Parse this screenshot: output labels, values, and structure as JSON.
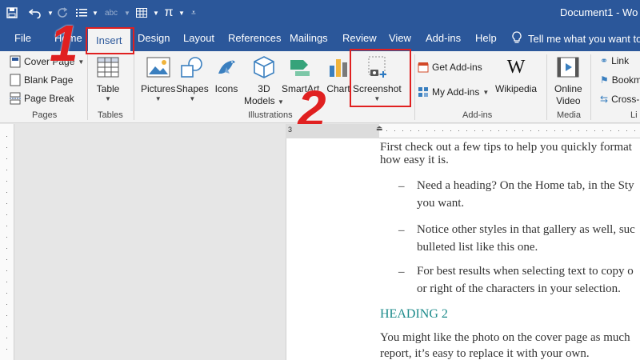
{
  "title_bar": {
    "document_title": "Document1 - Wo",
    "qat_icons": [
      "save-icon",
      "undo-icon",
      "redo-icon",
      "bullets-icon",
      "spelling-icon",
      "table-icon",
      "equation-icon",
      "customize-icon"
    ],
    "equation_glyph": "π"
  },
  "tabs": {
    "file": "File",
    "home": "Home",
    "insert": "Insert",
    "design": "Design",
    "layout": "Layout",
    "references": "References",
    "mailings": "Mailings",
    "review": "Review",
    "view": "View",
    "addins": "Add-ins",
    "help": "Help",
    "tell_me": "Tell me what you want to"
  },
  "ribbon": {
    "pages": {
      "cover_page": "Cover Page",
      "blank_page": "Blank Page",
      "page_break": "Page Break",
      "group_label": "Pages"
    },
    "tables": {
      "table": "Table",
      "group_label": "Tables"
    },
    "illustrations": {
      "pictures": "Pictures",
      "shapes": "Shapes",
      "icons": "Icons",
      "models_3d_line1": "3D",
      "models_3d_line2": "Models",
      "smartart": "SmartArt",
      "chart": "Chart",
      "screenshot": "Screenshot",
      "group_label": "Illustrations"
    },
    "addins": {
      "get_addins": "Get Add-ins",
      "my_addins": "My Add-ins",
      "wikipedia": "Wikipedia",
      "group_label": "Add-ins"
    },
    "media": {
      "online_video_line1": "Online",
      "online_video_line2": "Video",
      "group_label": "Media"
    },
    "links": {
      "link": "Link",
      "bookmark": "Bookm",
      "cross_ref": "Cross-",
      "group_label": "Li"
    }
  },
  "annotations": {
    "step1": "1",
    "step2": "2",
    "color": "#e02020"
  },
  "ruler": {
    "marker": "3",
    "tick_char": "·"
  },
  "document": {
    "para1_line1": "First check out a few tips to help you quickly format",
    "para1_line2": "how easy it is.",
    "bullet_char": "–",
    "bullet1_line1": "Need a heading? On the Home tab, in the Sty",
    "bullet1_line2": "you want.",
    "bullet2_line1": "Notice other styles in that gallery as well, suc",
    "bullet2_line2": "bulleted list like this one.",
    "bullet3_line1": "For best results when selecting text to copy o",
    "bullet3_line2": "or right of the characters in your selection.",
    "heading2": "HEADING 2",
    "para2_line1": "You might like the photo on the cover page as much",
    "para2_line2": "report, it’s easy to replace it with your own."
  },
  "colors": {
    "accent": "#2b579a",
    "heading": "#1b8a8a",
    "highlight": "#e02020"
  }
}
